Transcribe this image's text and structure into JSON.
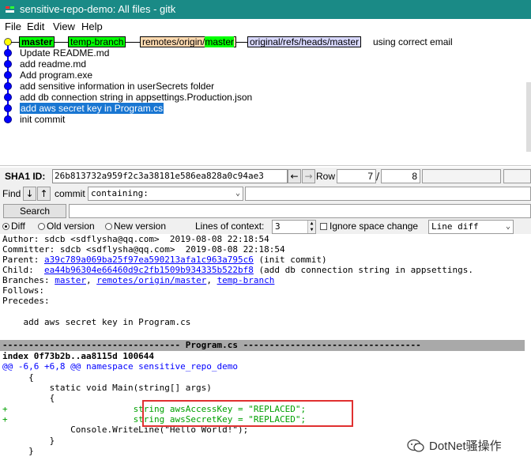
{
  "window": {
    "title": "sensitive-repo-demo: All files - gitk"
  },
  "menu": {
    "items": [
      "File",
      "Edit",
      "View",
      "Help"
    ]
  },
  "history": {
    "head_refs": {
      "local": [
        "master",
        "temp-branch"
      ],
      "remote_prefix": "remotes/origin/",
      "remote_branch": "master",
      "other": "original/refs/heads/master"
    },
    "commits": [
      "using correct email",
      "Update README.md",
      "add readme.md",
      "Add program.exe",
      "add sensitive information in userSecrets folder",
      "add db connection string in appsettings.Production.json",
      "add aws secret key in Program.cs",
      "init commit"
    ]
  },
  "sha": {
    "label": "SHA1 ID:",
    "value": "26b813732a959f2c3a38181e586ea828a0c94ae3",
    "row_label": "Row",
    "row": "7",
    "total": "8"
  },
  "find": {
    "label": "Find",
    "commit_label": "commit",
    "mode": "containing:"
  },
  "search": {
    "button": "Search"
  },
  "options": {
    "diff": "Diff",
    "old_version": "Old version",
    "new_version": "New version",
    "context_label": "Lines of context:",
    "context_value": "3",
    "ignore_space": "Ignore space change",
    "diff_mode": "Line diff"
  },
  "details": {
    "author": "Author: sdcb <sdflysha@qq.com>  2019-08-08 22:18:54",
    "committer": "Committer: sdcb <sdflysha@qq.com>  2019-08-08 22:18:54",
    "parent_label": "Parent: ",
    "parent_sha": "a39c789a069ba25f97ea590213afa1c963a795c6",
    "parent_desc": " (init commit)",
    "child_label": "Child:  ",
    "child_sha": "ea44b96304e66460d9c2fb1509b934335b522bf8",
    "child_desc": " (add db connection string in appsettings.",
    "branches_label": "Branches: ",
    "branches": [
      "master",
      "remotes/origin/master",
      "temp-branch"
    ],
    "follows": "Follows:",
    "precedes": "Precedes:",
    "message": "    add aws secret key in Program.cs"
  },
  "diff": {
    "file_header": "---------------------------------- Program.cs ----------------------------------",
    "index_line": "index 0f73b2b..aa8115d 100644",
    "hunk": "@@ -6,6 +6,8 @@ namespace sensitive_repo_demo",
    "lines": [
      "     {",
      "         static void Main(string[] args)",
      "         {",
      "+                        string awsAccessKey = \"REPLACED\";",
      "+                        string awsSecretKey = \"REPLACED\";",
      "             Console.WriteLine(\"Hello World!\");",
      "         }",
      "     }"
    ]
  },
  "watermark": {
    "text": "DotNet骚操作"
  },
  "colors": {
    "titlebar": "#1a8a86",
    "selection": "#1976d2",
    "added": "#00a000",
    "link": "#0000ff",
    "highlight_box": "#e03030"
  }
}
